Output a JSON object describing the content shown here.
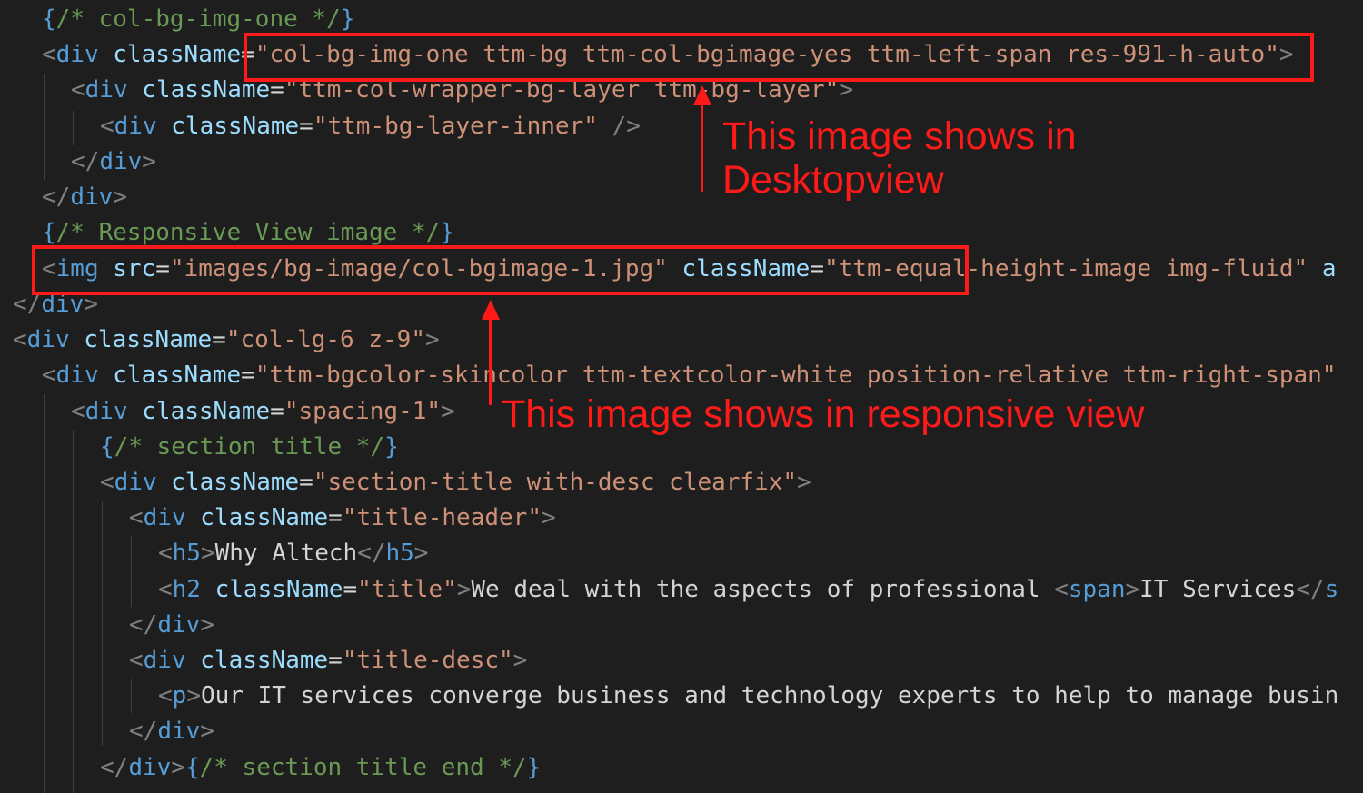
{
  "code_lines": [
    {
      "segments": [
        {
          "t": "{",
          "c": "brace"
        },
        {
          "t": "/* col-bg-img-one */",
          "c": "cmt"
        },
        {
          "t": "}",
          "c": "brace"
        }
      ]
    },
    {
      "segments": [
        {
          "t": "<",
          "c": "punct"
        },
        {
          "t": "div",
          "c": "tag"
        },
        {
          "t": " ",
          "c": "txt"
        },
        {
          "t": "className",
          "c": "attr"
        },
        {
          "t": "=",
          "c": "txt"
        },
        {
          "t": "\"col-bg-img-one ttm-bg ttm-col-bgimage-yes ttm-left-span res-991-h-auto\"",
          "c": "str"
        },
        {
          "t": ">",
          "c": "punct"
        }
      ]
    },
    {
      "segments": [
        {
          "t": "<",
          "c": "punct"
        },
        {
          "t": "div",
          "c": "tag"
        },
        {
          "t": " ",
          "c": "txt"
        },
        {
          "t": "className",
          "c": "attr"
        },
        {
          "t": "=",
          "c": "txt"
        },
        {
          "t": "\"ttm-col-wrapper-bg-layer ttm-bg-layer\"",
          "c": "str"
        },
        {
          "t": ">",
          "c": "punct"
        }
      ]
    },
    {
      "segments": [
        {
          "t": "<",
          "c": "punct"
        },
        {
          "t": "div",
          "c": "tag"
        },
        {
          "t": " ",
          "c": "txt"
        },
        {
          "t": "className",
          "c": "attr"
        },
        {
          "t": "=",
          "c": "txt"
        },
        {
          "t": "\"ttm-bg-layer-inner\"",
          "c": "str"
        },
        {
          "t": " />",
          "c": "punct"
        }
      ]
    },
    {
      "segments": [
        {
          "t": "</",
          "c": "punct"
        },
        {
          "t": "div",
          "c": "tag"
        },
        {
          "t": ">",
          "c": "punct"
        }
      ]
    },
    {
      "segments": [
        {
          "t": "</",
          "c": "punct"
        },
        {
          "t": "div",
          "c": "tag"
        },
        {
          "t": ">",
          "c": "punct"
        }
      ]
    },
    {
      "segments": [
        {
          "t": "{",
          "c": "brace"
        },
        {
          "t": "/* Responsive View image */",
          "c": "cmt"
        },
        {
          "t": "}",
          "c": "brace"
        }
      ]
    },
    {
      "segments": [
        {
          "t": "<",
          "c": "punct"
        },
        {
          "t": "img",
          "c": "tag"
        },
        {
          "t": " ",
          "c": "txt"
        },
        {
          "t": "src",
          "c": "attr"
        },
        {
          "t": "=",
          "c": "txt"
        },
        {
          "t": "\"images/bg-image/col-bgimage-1.jpg\"",
          "c": "str"
        },
        {
          "t": " ",
          "c": "txt"
        },
        {
          "t": "className",
          "c": "attr"
        },
        {
          "t": "=",
          "c": "txt"
        },
        {
          "t": "\"ttm-equal-height-image img-fluid\"",
          "c": "str"
        },
        {
          "t": " ",
          "c": "txt"
        },
        {
          "t": "a",
          "c": "attr"
        }
      ]
    },
    {
      "segments": [
        {
          "t": "</",
          "c": "punct"
        },
        {
          "t": "div",
          "c": "tag"
        },
        {
          "t": ">",
          "c": "punct"
        }
      ]
    },
    {
      "segments": [
        {
          "t": "<",
          "c": "punct"
        },
        {
          "t": "div",
          "c": "tag"
        },
        {
          "t": " ",
          "c": "txt"
        },
        {
          "t": "className",
          "c": "attr"
        },
        {
          "t": "=",
          "c": "txt"
        },
        {
          "t": "\"col-lg-6 z-9\"",
          "c": "str"
        },
        {
          "t": ">",
          "c": "punct"
        }
      ]
    },
    {
      "segments": [
        {
          "t": "<",
          "c": "punct"
        },
        {
          "t": "div",
          "c": "tag"
        },
        {
          "t": " ",
          "c": "txt"
        },
        {
          "t": "className",
          "c": "attr"
        },
        {
          "t": "=",
          "c": "txt"
        },
        {
          "t": "\"ttm-bgcolor-skincolor ttm-textcolor-white position-relative ttm-right-span\"",
          "c": "str"
        }
      ]
    },
    {
      "segments": [
        {
          "t": "<",
          "c": "punct"
        },
        {
          "t": "div",
          "c": "tag"
        },
        {
          "t": " ",
          "c": "txt"
        },
        {
          "t": "className",
          "c": "attr"
        },
        {
          "t": "=",
          "c": "txt"
        },
        {
          "t": "\"spacing-1\"",
          "c": "str"
        },
        {
          "t": ">",
          "c": "punct"
        }
      ]
    },
    {
      "segments": [
        {
          "t": "{",
          "c": "brace"
        },
        {
          "t": "/* section title */",
          "c": "cmt"
        },
        {
          "t": "}",
          "c": "brace"
        }
      ]
    },
    {
      "segments": [
        {
          "t": "<",
          "c": "punct"
        },
        {
          "t": "div",
          "c": "tag"
        },
        {
          "t": " ",
          "c": "txt"
        },
        {
          "t": "className",
          "c": "attr"
        },
        {
          "t": "=",
          "c": "txt"
        },
        {
          "t": "\"section-title with-desc clearfix\"",
          "c": "str"
        },
        {
          "t": ">",
          "c": "punct"
        }
      ]
    },
    {
      "segments": [
        {
          "t": "<",
          "c": "punct"
        },
        {
          "t": "div",
          "c": "tag"
        },
        {
          "t": " ",
          "c": "txt"
        },
        {
          "t": "className",
          "c": "attr"
        },
        {
          "t": "=",
          "c": "txt"
        },
        {
          "t": "\"title-header\"",
          "c": "str"
        },
        {
          "t": ">",
          "c": "punct"
        }
      ]
    },
    {
      "segments": [
        {
          "t": "<",
          "c": "punct"
        },
        {
          "t": "h5",
          "c": "tag"
        },
        {
          "t": ">",
          "c": "punct"
        },
        {
          "t": "Why Altech",
          "c": "txt"
        },
        {
          "t": "</",
          "c": "punct"
        },
        {
          "t": "h5",
          "c": "tag"
        },
        {
          "t": ">",
          "c": "punct"
        }
      ]
    },
    {
      "segments": [
        {
          "t": "<",
          "c": "punct"
        },
        {
          "t": "h2",
          "c": "tag"
        },
        {
          "t": " ",
          "c": "txt"
        },
        {
          "t": "className",
          "c": "attr"
        },
        {
          "t": "=",
          "c": "txt"
        },
        {
          "t": "\"title\"",
          "c": "str"
        },
        {
          "t": ">",
          "c": "punct"
        },
        {
          "t": "We deal with the aspects of professional ",
          "c": "txt"
        },
        {
          "t": "<",
          "c": "punct"
        },
        {
          "t": "span",
          "c": "tag"
        },
        {
          "t": ">",
          "c": "punct"
        },
        {
          "t": "IT Services",
          "c": "txt"
        },
        {
          "t": "</",
          "c": "punct"
        },
        {
          "t": "s",
          "c": "tag"
        }
      ]
    },
    {
      "segments": [
        {
          "t": "</",
          "c": "punct"
        },
        {
          "t": "div",
          "c": "tag"
        },
        {
          "t": ">",
          "c": "punct"
        }
      ]
    },
    {
      "segments": [
        {
          "t": "<",
          "c": "punct"
        },
        {
          "t": "div",
          "c": "tag"
        },
        {
          "t": " ",
          "c": "txt"
        },
        {
          "t": "className",
          "c": "attr"
        },
        {
          "t": "=",
          "c": "txt"
        },
        {
          "t": "\"title-desc\"",
          "c": "str"
        },
        {
          "t": ">",
          "c": "punct"
        }
      ]
    },
    {
      "segments": [
        {
          "t": "<",
          "c": "punct"
        },
        {
          "t": "p",
          "c": "tag"
        },
        {
          "t": ">",
          "c": "punct"
        },
        {
          "t": "Our IT services converge business and technology experts to help to manage busin",
          "c": "txt"
        }
      ]
    },
    {
      "segments": [
        {
          "t": "</",
          "c": "punct"
        },
        {
          "t": "div",
          "c": "tag"
        },
        {
          "t": ">",
          "c": "punct"
        }
      ]
    },
    {
      "segments": [
        {
          "t": "</",
          "c": "punct"
        },
        {
          "t": "div",
          "c": "tag"
        },
        {
          "t": ">",
          "c": "punct"
        },
        {
          "t": "{",
          "c": "brace"
        },
        {
          "t": "/* section title end */",
          "c": "cmt"
        },
        {
          "t": "}",
          "c": "brace"
        }
      ]
    }
  ],
  "annotations": {
    "desktop_note": "This image shows in\nDesktopview",
    "responsive_note": "This image shows in responsive view"
  },
  "colors": {
    "background": "#1e1e1e",
    "annotation": "#ff1a1a",
    "tag": "#569cd6",
    "attribute": "#9cdcfe",
    "string": "#ce9178",
    "comment": "#6a9955"
  }
}
